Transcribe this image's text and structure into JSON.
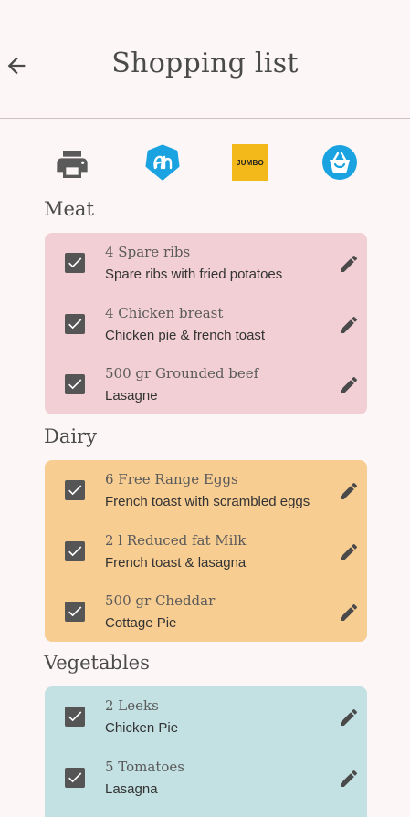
{
  "app_bar": {
    "title": "Shopping list"
  },
  "shops": [
    {
      "name": "printer"
    },
    {
      "name": "albert-heijn"
    },
    {
      "name": "jumbo",
      "label": "JUMBO"
    },
    {
      "name": "basket"
    }
  ],
  "sections": [
    {
      "label": "Meat",
      "color": "#f1cfd4",
      "items": [
        {
          "title": "4 Spare ribs",
          "recipe": "Spare ribs with fried potatoes",
          "checked": true
        },
        {
          "title": "4 Chicken breast",
          "recipe": "Chicken pie & french toast",
          "checked": true
        },
        {
          "title": "500 gr Grounded beef",
          "recipe": "Lasagne",
          "checked": true
        }
      ]
    },
    {
      "label": "Dairy",
      "color": "#f7cd92",
      "items": [
        {
          "title": "6 Free Range Eggs",
          "recipe": "French toast with scrambled eggs",
          "checked": true
        },
        {
          "title": "2 l Reduced fat Milk",
          "recipe": "French toast & lasagna",
          "checked": true
        },
        {
          "title": "500 gr Cheddar",
          "recipe": "Cottage Pie",
          "checked": true
        }
      ]
    },
    {
      "label": "Vegetables",
      "color": "#c3e0e2",
      "items": [
        {
          "title": "2 Leeks",
          "recipe": "Chicken Pie",
          "checked": true
        },
        {
          "title": "5 Tomatoes",
          "recipe": "Lasagna",
          "checked": true
        }
      ]
    }
  ],
  "colors": {
    "icon_blue": "#1aa3e0",
    "jumbo_yellow": "#f3b81a",
    "checkbox": "#555555"
  }
}
